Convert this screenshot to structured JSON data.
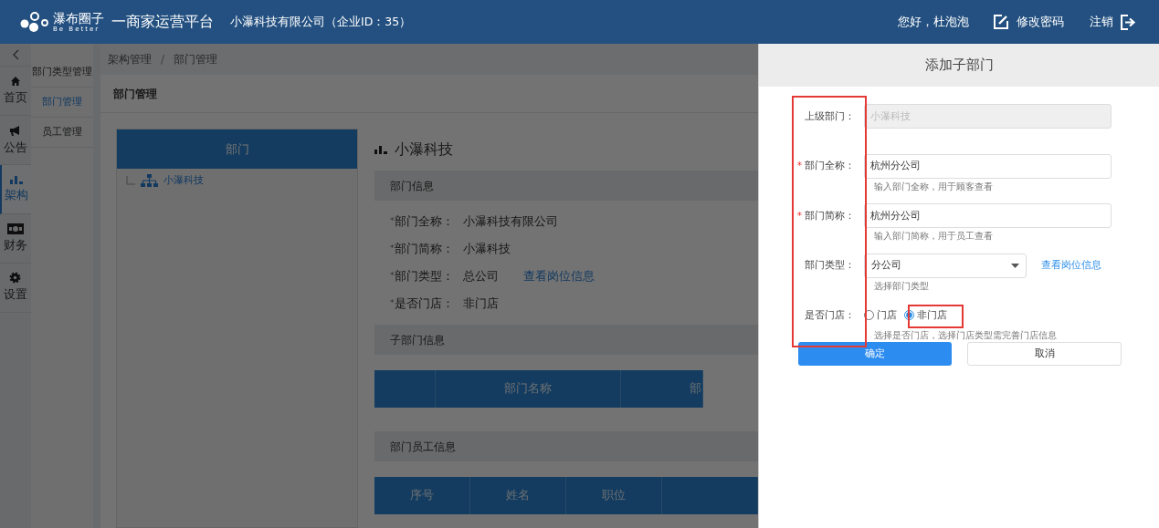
{
  "header": {
    "logo_name": "瀑布圈子",
    "logo_tagline": "Be Better",
    "platform": "一商家运营平台",
    "company": "小瀑科技有限公司（企业ID：35）",
    "greeting": "您好，杜泡泡",
    "change_password": "修改密码",
    "logout": "注销"
  },
  "nav": [
    {
      "label": "首页",
      "selected": false
    },
    {
      "label": "公告",
      "selected": false
    },
    {
      "label": "架构",
      "selected": true
    },
    {
      "label": "财务",
      "selected": false
    },
    {
      "label": "设置",
      "selected": false
    }
  ],
  "submenu": [
    {
      "label": "部门类型管理",
      "selected": false
    },
    {
      "label": "部门管理",
      "selected": true
    },
    {
      "label": "员工管理",
      "selected": false
    }
  ],
  "breadcrumb": [
    "架构管理",
    "部门管理"
  ],
  "breadcrumb_separator": "/",
  "card_title": "部门管理",
  "tree": {
    "header": "部门",
    "nodes": [
      {
        "label": "小瀑科技"
      }
    ]
  },
  "detail": {
    "title": "小瀑科技",
    "info_title": "部门信息",
    "info": [
      {
        "mark": "*",
        "label": "部门全称：",
        "value": "小瀑科技有限公司"
      },
      {
        "mark": "*",
        "label": "部门简称：",
        "value": "小瀑科技"
      },
      {
        "mark": "*",
        "label": "部门类型：",
        "value": "总公司",
        "link": "查看岗位信息"
      },
      {
        "mark": "*",
        "label": "是否门店：",
        "value": "非门店"
      }
    ],
    "sub_title": "子部门信息",
    "sub_columns": [
      "",
      "部门名称",
      "部"
    ],
    "staff_title": "部门员工信息",
    "staff_columns": [
      "序号",
      "姓名",
      "职位",
      ""
    ]
  },
  "dialog": {
    "title": "添加子部门",
    "fields": [
      {
        "kind": "input",
        "label": "上级部门：",
        "disabled": true,
        "value": "小瀑科技"
      },
      {
        "kind": "input",
        "required_mark": "*",
        "label": "部门全称：",
        "disabled": false,
        "value": "杭州分公司",
        "hint": "输入部门全称，用于顾客查看"
      },
      {
        "kind": "input",
        "required_mark": "*",
        "label": "部门简称：",
        "disabled": false,
        "value": "杭州分公司",
        "hint": "输入部门简称，用于员工查看"
      },
      {
        "kind": "select",
        "label": "部门类型：",
        "value": "分公司",
        "link": "查看岗位信息",
        "hint": "选择部门类型"
      },
      {
        "kind": "radio",
        "label": "是否门店：",
        "options": [
          {
            "label": "门店",
            "selected": false
          },
          {
            "label": "非门店",
            "selected": true
          }
        ],
        "hint": "选择是否门店，选择门店类型需完善门店信息"
      }
    ],
    "confirm": "确定",
    "cancel": "取消"
  }
}
